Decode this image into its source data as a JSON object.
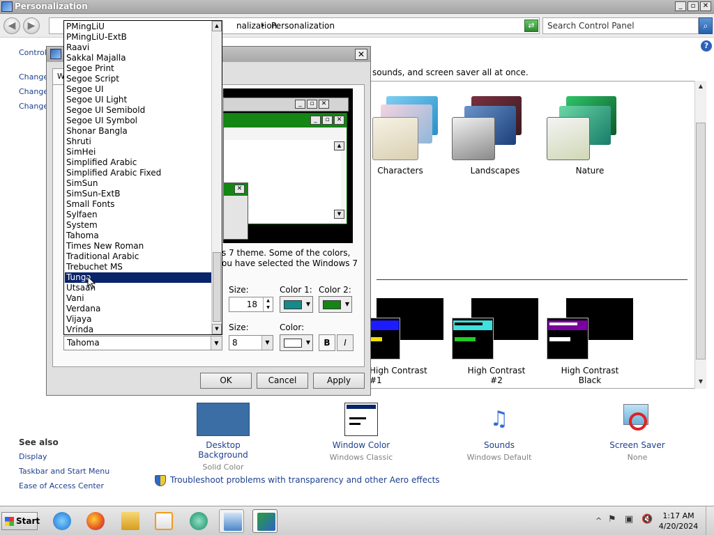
{
  "window": {
    "title": "Personalization",
    "min": "_",
    "max": "▫",
    "close": "✕"
  },
  "address": {
    "crumb1": "nalization",
    "crumb2": "Personalization",
    "sep": "▸",
    "search_placeholder": "Search Control Panel"
  },
  "left_nav": {
    "control": "Control",
    "change1": "Change",
    "change2": "Change",
    "change3": "Change"
  },
  "intro_text": "sounds, and screen saver all at once.",
  "themes": [
    {
      "label": "Characters"
    },
    {
      "label": "Landscapes"
    },
    {
      "label": "Nature"
    }
  ],
  "contrast_themes": [
    {
      "label": "High Contrast #1"
    },
    {
      "label": "High Contrast #2"
    },
    {
      "label": "High Contrast Black"
    }
  ],
  "bottom_items": [
    {
      "title": "Desktop Background",
      "sub": "Solid Color"
    },
    {
      "title": "Window Color",
      "sub": "Windows Classic"
    },
    {
      "title": "Sounds",
      "sub": "Windows Default"
    },
    {
      "title": "Screen Saver",
      "sub": "None"
    }
  ],
  "see_also": {
    "heading": "See also",
    "links": [
      "Display",
      "Taskbar and Start Menu",
      "Ease of Access Center"
    ]
  },
  "troubleshoot": "Troubleshoot problems with transparency and other Aero effects",
  "dialog": {
    "tab_label": "W",
    "close": "✕",
    "note_line1": "s 7 theme.  Some of the colors,",
    "note_line2": "ou have selected the Windows 7",
    "item_size_label": "Size:",
    "color1_label": "Color 1:",
    "color2_label": "Color 2:",
    "item_size_value": "18",
    "font_size_label": "Size:",
    "font_color_label": "Color:",
    "font_size_value": "8",
    "bold": "B",
    "italic": "I",
    "ok": "OK",
    "cancel": "Cancel",
    "apply": "Apply",
    "color1": "#158a8a",
    "color2": "#138613",
    "font_color": "#ffffff"
  },
  "font_list": {
    "items": [
      "PMingLiU",
      "PMingLiU-ExtB",
      "Raavi",
      "Sakkal Majalla",
      "Segoe Print",
      "Segoe Script",
      "Segoe UI",
      "Segoe UI Light",
      "Segoe UI Semibold",
      "Segoe UI Symbol",
      "Shonar Bangla",
      "Shruti",
      "SimHei",
      "Simplified Arabic",
      "Simplified Arabic Fixed",
      "SimSun",
      "SimSun-ExtB",
      "Small Fonts",
      "Sylfaen",
      "System",
      "Tahoma",
      "Times New Roman",
      "Traditional Arabic",
      "Trebuchet MS",
      "Tunga",
      "Utsaah",
      "Vani",
      "Verdana",
      "Vijaya",
      "Vrinda"
    ],
    "selected": "Tunga",
    "current_value": "Tahoma"
  },
  "taskbar": {
    "start": "Start",
    "time": "1:17 AM",
    "date": "4/20/2024",
    "chevron": "^"
  }
}
